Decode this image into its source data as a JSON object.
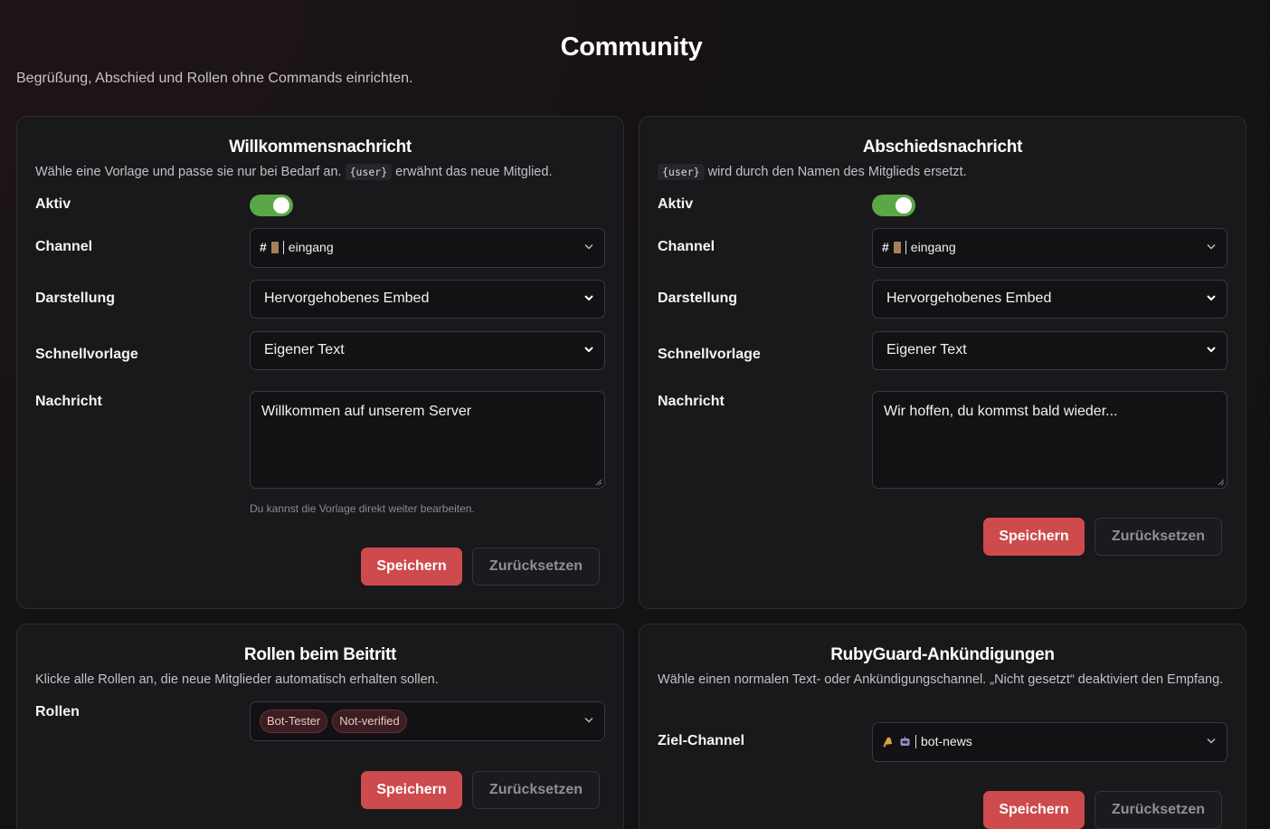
{
  "page": {
    "title": "Community",
    "subtitle": "Begrüßung, Abschied und Rollen ohne Commands einrichten."
  },
  "welcome": {
    "title": "Willkommensnachricht",
    "desc_before": "Wähle eine Vorlage und passe sie nur bei Bedarf an. ",
    "desc_code": "{user}",
    "desc_after": " erwähnt das neue Mitglied.",
    "active_label": "Aktiv",
    "active": true,
    "channel_label": "Channel",
    "channel_value": "eingang",
    "display_label": "Darstellung",
    "display_value": "Hervorgehobenes Embed",
    "template_label": "Schnellvorlage",
    "template_value": "Eigener Text",
    "message_label": "Nachricht",
    "message_value": "Willkommen auf unserem Server",
    "hint": "Du kannst die Vorlage direkt weiter bearbeiten.",
    "save_label": "Speichern",
    "reset_label": "Zurücksetzen"
  },
  "farewell": {
    "title": "Abschiedsnachricht",
    "desc_code": "{user}",
    "desc_after": " wird durch den Namen des Mitglieds ersetzt.",
    "active_label": "Aktiv",
    "active": true,
    "channel_label": "Channel",
    "channel_value": "eingang",
    "display_label": "Darstellung",
    "display_value": "Hervorgehobenes Embed",
    "template_label": "Schnellvorlage",
    "template_value": "Eigener Text",
    "message_label": "Nachricht",
    "message_value": "Wir hoffen, du kommst bald wieder...",
    "save_label": "Speichern",
    "reset_label": "Zurücksetzen"
  },
  "roles": {
    "title": "Rollen beim Beitritt",
    "desc": "Klicke alle Rollen an, die neue Mitglieder automatisch erhalten sollen.",
    "roles_label": "Rollen",
    "selected": [
      "Bot-Tester",
      "Not-verified"
    ],
    "save_label": "Speichern",
    "reset_label": "Zurücksetzen"
  },
  "announcements": {
    "title": "RubyGuard-Ankündigungen",
    "desc": "Wähle einen normalen Text- oder Ankündigungschannel. „Nicht gesetzt“ deaktiviert den Empfang.",
    "target_label": "Ziel-Channel",
    "target_value": "bot-news",
    "save_label": "Speichern",
    "reset_label": "Zurücksetzen"
  },
  "colors": {
    "accent": "#cd4a4d",
    "toggle_on": "#5aa845",
    "card_bg": "#19181b"
  },
  "icons": {
    "chevron": "chevron-down-icon",
    "channel_door": "door-icon",
    "bell": "bell-icon",
    "robot": "robot-icon"
  }
}
